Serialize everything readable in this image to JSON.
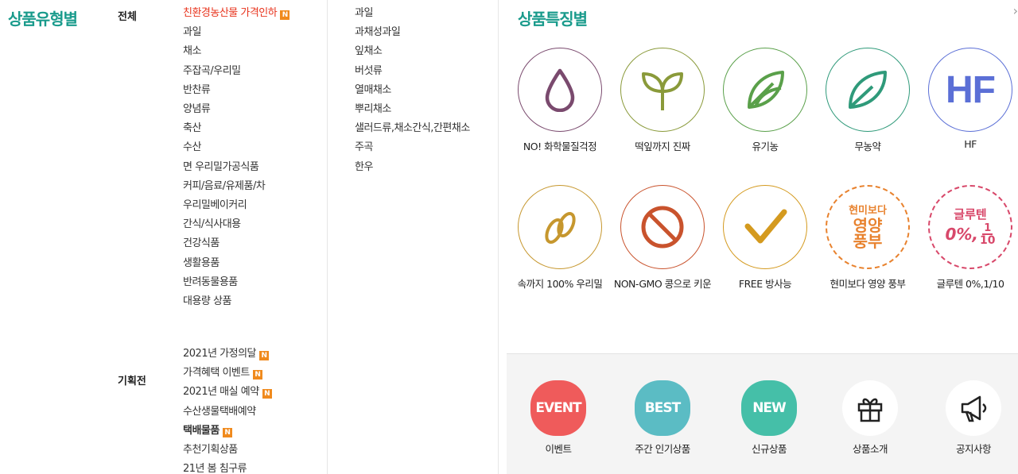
{
  "left": {
    "title": "상품유형별",
    "all_label": "전체",
    "plan_label": "기획전",
    "col1": [
      {
        "label": "친환경농산물 가격인하",
        "new": true,
        "highlight": true
      },
      {
        "label": "과일"
      },
      {
        "label": "채소"
      },
      {
        "label": "주잡곡/우리밀"
      },
      {
        "label": "반찬류"
      },
      {
        "label": "양념류"
      },
      {
        "label": "축산"
      },
      {
        "label": "수산"
      },
      {
        "label": "면 우리밀가공식품"
      },
      {
        "label": "커피/음료/유제품/차"
      },
      {
        "label": "우리밀베이커리"
      },
      {
        "label": "간식/식사대용"
      },
      {
        "label": "건강식품"
      },
      {
        "label": "생활용품"
      },
      {
        "label": "반려동물용품"
      },
      {
        "label": "대용량 상품"
      }
    ],
    "col2": [
      {
        "label": "과일"
      },
      {
        "label": "과채성과일"
      },
      {
        "label": "잎채소"
      },
      {
        "label": "버섯류"
      },
      {
        "label": "열매채소"
      },
      {
        "label": "뿌리채소"
      },
      {
        "label": "샐러드류,채소간식,간편채소"
      },
      {
        "label": "주곡"
      },
      {
        "label": "한우"
      }
    ],
    "plan_items": [
      {
        "label": "2021년 가정의달",
        "new": true
      },
      {
        "label": "가격혜택 이벤트",
        "new": true
      },
      {
        "label": "2021년 매실 예약",
        "new": true
      },
      {
        "label": "수산생물택배예약"
      },
      {
        "label": "택배물품",
        "new": true,
        "bold": true
      },
      {
        "label": "추천기획상품"
      },
      {
        "label": "21년 봄 침구류"
      }
    ],
    "new_badge": "N"
  },
  "right": {
    "title": "상품특징별",
    "close": "›",
    "features_row1": [
      {
        "label": "NO! 화학물질걱정",
        "color": "#7a4a6e",
        "icon": "drop-icon"
      },
      {
        "label": "떡잎까지 진짜",
        "color": "#8a9a3a",
        "icon": "sprout-icon"
      },
      {
        "label": "유기농",
        "color": "#5aa04a",
        "icon": "leaves-icon"
      },
      {
        "label": "무농약",
        "color": "#2f9a7a",
        "icon": "leaf-icon"
      },
      {
        "label": "HF",
        "color": "#5b6fd6",
        "icon": "hf-icon"
      }
    ],
    "hf_text": "HF",
    "features_row2": [
      {
        "label": "속까지 100% 우리밀",
        "color": "#c6972e",
        "icon": "wheat-icon"
      },
      {
        "label": "NON-GMO 콩으로 키운",
        "color": "#c9532d",
        "icon": "prohibit-icon"
      },
      {
        "label": "FREE 방사능",
        "color": "#d49a1f",
        "icon": "check-icon"
      },
      {
        "label": "현미보다 영양 풍부",
        "color": "#e8822e",
        "icon": "stamp-icon"
      },
      {
        "label": "글루텐 0%,1/10",
        "color": "#d8486a",
        "icon": "gluten-icon"
      }
    ],
    "stamp_text": {
      "top": "현미보다",
      "mid": "영양",
      "bot": "풍부"
    },
    "gluten_text": {
      "top": "글루텐",
      "zero": "0%,",
      "num": "1",
      "den": "10"
    },
    "bottom": [
      {
        "label": "이벤트",
        "badge": "EVENT",
        "color": "#ef5b5b",
        "icon": "event-badge-icon"
      },
      {
        "label": "주간 인기상품",
        "badge": "BEST",
        "color": "#5bbcc4",
        "icon": "best-badge-icon"
      },
      {
        "label": "신규상품",
        "badge": "NEW",
        "color": "#45bfa8",
        "icon": "new-badge-icon"
      },
      {
        "label": "상품소개",
        "icon": "gift-icon"
      },
      {
        "label": "공지사항",
        "icon": "megaphone-icon"
      }
    ]
  }
}
